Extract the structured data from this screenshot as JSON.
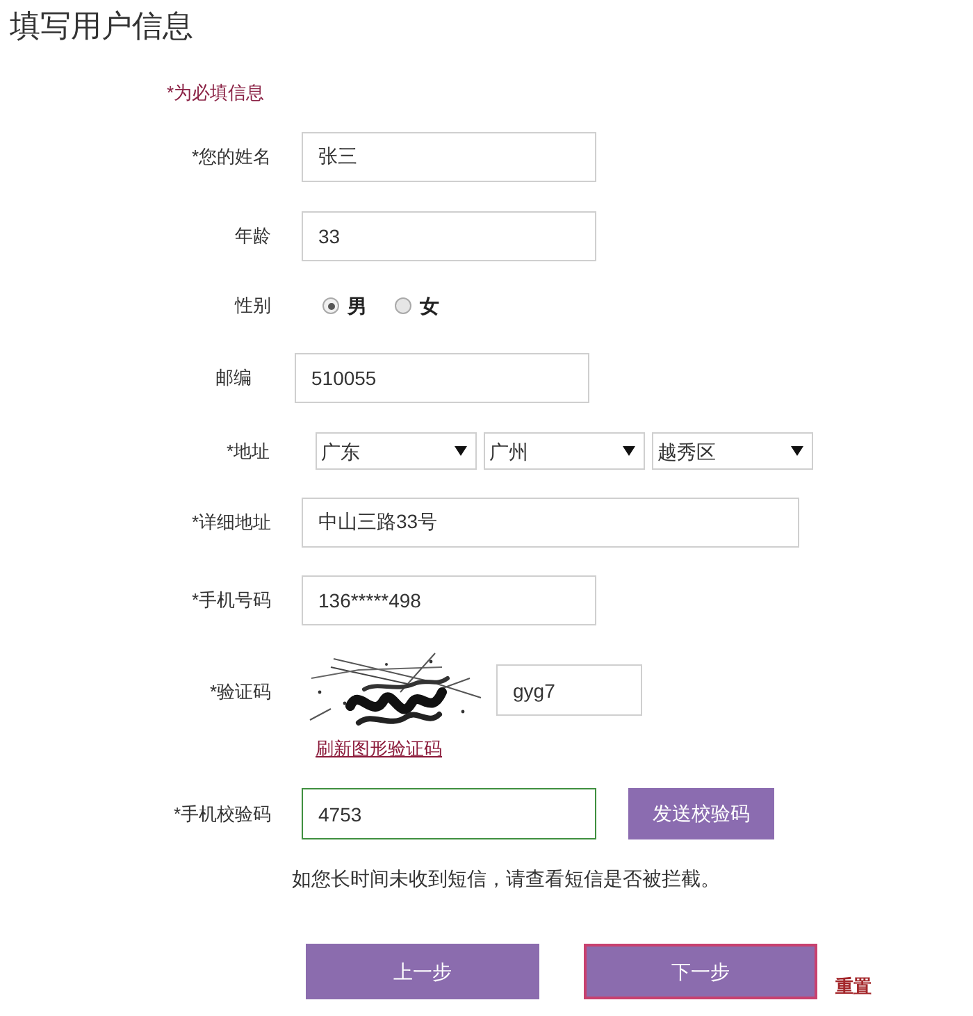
{
  "title": "填写用户信息",
  "required_note": "*为必填信息",
  "fields": [
    {
      "kind": "text",
      "label": "*您的姓名",
      "value": "张三"
    },
    {
      "kind": "text",
      "label": "年龄",
      "value": "33"
    },
    {
      "kind": "radio",
      "label": "性别",
      "options": [
        {
          "label": "男",
          "selected": true
        },
        {
          "label": "女",
          "selected": false
        }
      ]
    },
    {
      "kind": "text",
      "label": "邮编",
      "value": "510055"
    },
    {
      "kind": "selects",
      "label": "*地址",
      "selects": [
        {
          "value": "广东"
        },
        {
          "value": "广州"
        },
        {
          "value": "越秀区"
        }
      ]
    },
    {
      "kind": "long_text",
      "label": "*详细地址",
      "value": "中山三路33号"
    },
    {
      "kind": "text",
      "label": "*手机号码",
      "value": "136*****498"
    },
    {
      "kind": "captcha",
      "label": "*验证码",
      "value": "gyg7",
      "refresh_link": "刷新图形验证码"
    },
    {
      "kind": "sms",
      "label": "*手机校验码",
      "value": "4753",
      "focused": true,
      "button": "发送校验码"
    }
  ],
  "sms_note": "如您长时间未收到短信，请查看短信是否被拦截。",
  "actions": [
    {
      "label": "上一步",
      "focused": false
    },
    {
      "label": "下一步",
      "focused": true
    }
  ],
  "reset_link": "重置"
}
